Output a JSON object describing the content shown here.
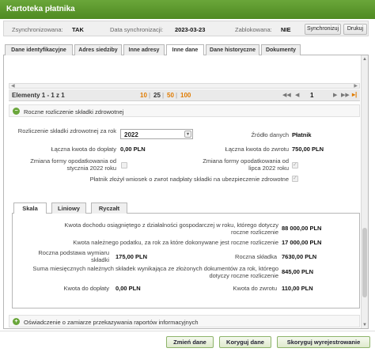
{
  "window": {
    "title": "Kartoteka płatnika"
  },
  "sync": {
    "synced_label": "Zsynchronizowana:",
    "synced_value": "TAK",
    "date_label": "Data synchronizacji:",
    "date_value": "2023-03-23",
    "locked_label": "Zablokowana:",
    "locked_value": "NIE",
    "sync_button": "Synchronizuj",
    "print_button": "Drukuj"
  },
  "tabs": [
    {
      "label": "Dane identyfikacyjne"
    },
    {
      "label": "Adres siedziby"
    },
    {
      "label": "Inne adresy"
    },
    {
      "label": "Inne dane"
    },
    {
      "label": "Dane historyczne"
    },
    {
      "label": "Dokumenty"
    }
  ],
  "pager": {
    "elements": "Elementy 1 - 1 z 1",
    "sizes": [
      "10",
      "25",
      "50",
      "100"
    ],
    "current_page": "1"
  },
  "section_annual": {
    "title": "Roczne rozliczenie składki zdrowotnej"
  },
  "form": {
    "year_label": "Rozliczenie składki zdrowotnej za rok",
    "year_value": "2022",
    "source_label": "Źródło danych",
    "source_value": "Płatnik",
    "to_pay_label": "Łączna kwota do dopłaty",
    "to_pay_value": "0,00 PLN",
    "to_refund_label": "Łączna kwota do zwrotu",
    "to_refund_value": "750,00 PLN",
    "change_jan_label": "Zmiana formy opodatkowania od stycznia 2022 roku",
    "change_jul_label": "Zmiana formy opodatkowania od lipca 2022 roku",
    "refund_request_label": "Płatnik złożył wniosek o zwrot nadpłaty składki na ubezpieczenie zdrowotne"
  },
  "subtabs": [
    {
      "label": "Skala"
    },
    {
      "label": "Liniowy"
    },
    {
      "label": "Ryczałt"
    }
  ],
  "scale": {
    "income_label": "Kwota dochodu osiągniętego z działalności gospodarczej w roku, którego dotyczy roczne rozliczenie",
    "income_value": "88 000,00 PLN",
    "tax_label": "Kwota należnego podatku, za rok za które dokonywane jest roczne rozliczenie",
    "tax_value": "17 000,00 PLN",
    "base_label": "Roczna podstawa wymiaru składki",
    "base_value": "175,00 PLN",
    "annual_label": "Roczna składka",
    "annual_value": "7630,00 PLN",
    "sum_label": "Suma miesięcznych należnych składek wynikająca ze złożonych dokumentów za rok, którego dotyczy roczne rozliczenie",
    "sum_value": "845,00 PLN",
    "pay_label": "Kwota do dopłaty",
    "pay_value": "0,00 PLN",
    "refund_label": "Kwota do zwrotu",
    "refund_value": "110,00 PLN"
  },
  "section_next": {
    "title": "Oświadczenie o zamiarze przekazywania raportów informacyjnych"
  },
  "footer": {
    "change_button": "Zmień dane",
    "correct_button": "Koryguj dane",
    "deregister_button": "Skoryguj wyrejestrowanie"
  }
}
